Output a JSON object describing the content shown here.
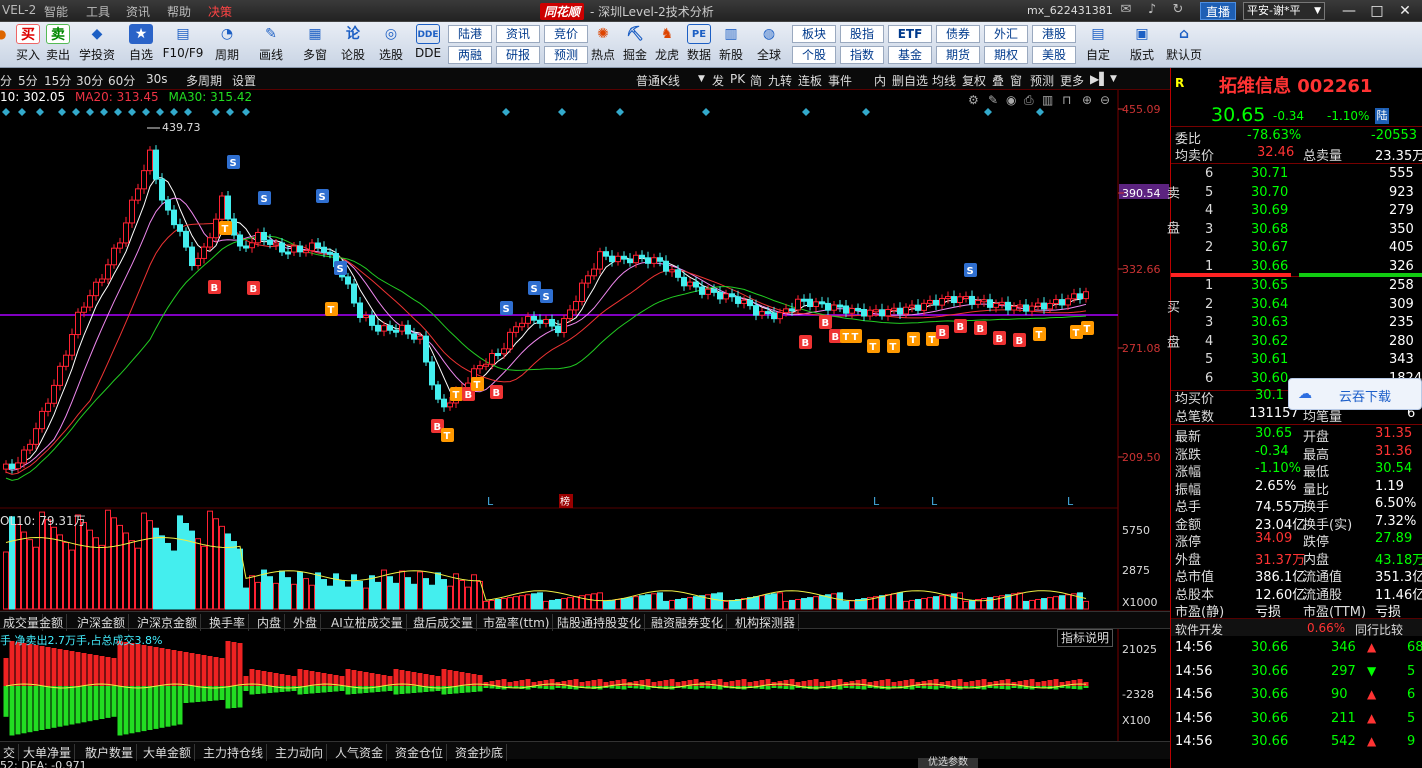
{
  "menu": {
    "items": [
      "VEL-2",
      "智能",
      "工具",
      "资讯",
      "帮助",
      "决策"
    ],
    "logo": "同花顺",
    "app_title": "- 深圳Level-2技术分析",
    "user": "mx_622431381",
    "live_btn": "直播",
    "broker": "平安-谢*平"
  },
  "toolbar": {
    "buttons": [
      {
        "icon": "买",
        "label": "买入"
      },
      {
        "icon": "卖",
        "label": "卖出"
      },
      {
        "icon": "◆",
        "label": "学投资"
      },
      {
        "icon": "★",
        "label": "自选"
      },
      {
        "icon": "▤",
        "label": "F10/F9"
      },
      {
        "icon": "◔",
        "label": "周期"
      },
      {
        "icon": "✎",
        "label": "画线"
      },
      {
        "icon": "▦",
        "label": "多窗"
      },
      {
        "icon": "论",
        "label": "论股"
      },
      {
        "icon": "◎",
        "label": "选股"
      },
      {
        "icon": "DDE",
        "label": "DDE"
      }
    ],
    "pairs": [
      [
        "陆港",
        "两融"
      ],
      [
        "资讯",
        "研报"
      ],
      [
        "竞价",
        "预测"
      ]
    ],
    "buttons2": [
      {
        "icon": "✺",
        "label": "热点"
      },
      {
        "icon": "⛏",
        "label": "掘金"
      },
      {
        "icon": "♞",
        "label": "龙虎"
      },
      {
        "icon": "PE",
        "label": "数据"
      },
      {
        "icon": "▥",
        "label": "新股"
      },
      {
        "icon": "◍",
        "label": "全球"
      }
    ],
    "pairs2": [
      [
        "板块",
        "个股"
      ],
      [
        "股指",
        "指数"
      ],
      [
        "ETF",
        "基金"
      ],
      [
        "债券",
        "期货"
      ],
      [
        "外汇",
        "期权"
      ],
      [
        "港股",
        "美股"
      ]
    ],
    "buttons3": [
      {
        "icon": "▤",
        "label": "自定"
      },
      {
        "icon": "▣",
        "label": "版式"
      },
      {
        "icon": "⌂",
        "label": "默认页"
      }
    ]
  },
  "periods": {
    "items": [
      "分",
      "5分",
      "15分",
      "30分",
      "60分",
      "30s",
      "多周期",
      "设置"
    ]
  },
  "chart_tools": {
    "kline_type": "普通K线",
    "items": [
      "发",
      "PK",
      "简",
      "九转",
      "连板",
      "事件",
      "内",
      "删自选",
      "均线",
      "复权",
      "叠",
      "窗",
      "预测",
      "更多"
    ]
  },
  "ma_legend": {
    "ma10": "10: 302.05",
    "ma20": "MA20: 313.45",
    "ma30": "MA30: 315.42"
  },
  "price_axis": {
    "labels": [
      "455.09",
      "390.54",
      "332.66",
      "271.08",
      "209.50"
    ],
    "current": "390.54",
    "high_marker": "439.73"
  },
  "event_markers": {
    "letters": [
      "L",
      "L",
      "L",
      "L"
    ],
    "rank": "榜"
  },
  "volume": {
    "label": "OL10: 79.31万",
    "axis": [
      "5750",
      "2875",
      "X1000"
    ]
  },
  "indicator_tabs": {
    "items": [
      "成交量",
      "金额",
      "沪深金额",
      "沪深京金额",
      "换手率",
      "内盘",
      "外盘",
      "AI立桩成交量",
      "盘后成交量",
      "市盈率(ttm)",
      "陆股通持股变化",
      "融资融券变化",
      "机构探测器"
    ],
    "explain": "指标说明"
  },
  "netflow": {
    "text": "手 净卖出2.7万手,占总成交3.8%",
    "axis": [
      "21025",
      "-2328",
      "X100"
    ]
  },
  "bottom_tabs": {
    "items": [
      "交",
      "大单净量",
      "散户数量",
      "大单金额",
      "主力持仓线",
      "主力动向",
      "人气资金",
      "资金仓位",
      "资金抄底"
    ],
    "dea": "52: DEA: -0.971"
  },
  "quote": {
    "badge": "R",
    "name": "拓维信息 002261",
    "price": "30.65",
    "change": "-0.34",
    "pct": "-1.10%",
    "exchange": "陆",
    "weibi": [
      "委比",
      "-78.63%",
      "-20553"
    ],
    "avg_sell": [
      "均卖价",
      "32.46",
      "总卖量",
      "23.35万"
    ],
    "sell": [
      [
        "6",
        "30.71",
        "555"
      ],
      [
        "5",
        "30.70",
        "923"
      ],
      [
        "4",
        "30.69",
        "279"
      ],
      [
        "3",
        "30.68",
        "350"
      ],
      [
        "2",
        "30.67",
        "405"
      ],
      [
        "1",
        "30.66",
        "326"
      ]
    ],
    "buy": [
      [
        "1",
        "30.65",
        "258"
      ],
      [
        "2",
        "30.64",
        "309"
      ],
      [
        "3",
        "30.63",
        "235"
      ],
      [
        "4",
        "30.62",
        "280"
      ],
      [
        "5",
        "30.61",
        "343"
      ],
      [
        "6",
        "30.60",
        "1824"
      ]
    ],
    "sell_side": "卖盘",
    "buy_side": "买盘",
    "avg_buy": [
      "均买价",
      "30.1"
    ],
    "total_bids": [
      "总笔数",
      "131157",
      "均笔量",
      "6"
    ],
    "stats": [
      [
        "最新",
        "30.65",
        "开盘",
        "31.35"
      ],
      [
        "涨跌",
        "-0.34",
        "最高",
        "31.36"
      ],
      [
        "涨幅",
        "-1.10%",
        "最低",
        "30.54"
      ],
      [
        "振幅",
        "2.65%",
        "量比",
        "1.19"
      ],
      [
        "总手",
        "74.55万",
        "换手",
        "6.50%"
      ],
      [
        "金额",
        "23.04亿",
        "换手(实)",
        "7.32%"
      ],
      [
        "涨停",
        "34.09",
        "跌停",
        "27.89"
      ],
      [
        "外盘",
        "31.37万",
        "内盘",
        "43.18万"
      ],
      [
        "总市值",
        "386.1亿",
        "流通值",
        "351.3亿"
      ],
      [
        "总股本",
        "12.60亿",
        "流通股",
        "11.46亿"
      ],
      [
        "市盈(静)",
        "亏损",
        "市盈(TTM)",
        "亏损"
      ]
    ],
    "sector": [
      "软件开发",
      "0.66%",
      "同行比较"
    ],
    "ticks": [
      [
        "14:56",
        "30.66",
        "346",
        "68"
      ],
      [
        "14:56",
        "30.66",
        "297",
        "5"
      ],
      [
        "14:56",
        "30.66",
        "90",
        "6"
      ],
      [
        "14:56",
        "30.66",
        "211",
        "5"
      ],
      [
        "14:56",
        "30.66",
        "542",
        "9"
      ]
    ]
  },
  "cloud": {
    "label": "云吞下载"
  },
  "tape_btn": "优选参数"
}
